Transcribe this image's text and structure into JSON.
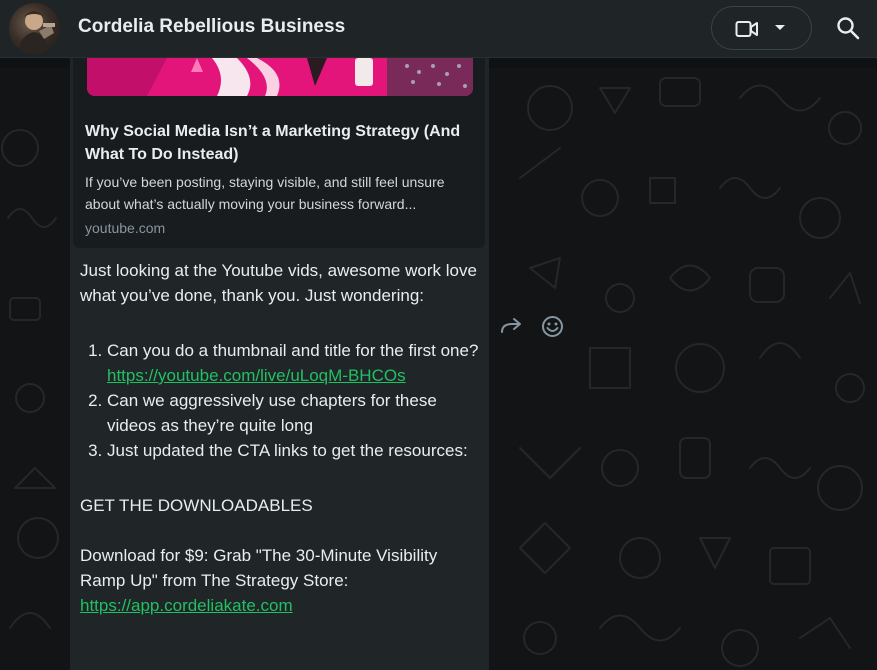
{
  "header": {
    "chat_title": "Cordelia Rebellious Business",
    "icons": [
      "avatar",
      "video-call-icon",
      "chevron-down-icon",
      "search-icon"
    ]
  },
  "link_preview": {
    "title": "Why Social Media Isn’t a Marketing Strategy (And What To Do Instead)",
    "description": "If you’ve been posting, staying visible, and still feel unsure about what’s actually moving your business forward...",
    "domain": "youtube.com"
  },
  "message": {
    "intro": "Just looking at the Youtube vids, awesome work love what you’ve done, thank you. Just wondering:",
    "item1_text": "Can you do a thumbnail and title for the first one? ",
    "item1_link": "https://youtube.com/live/uLoqM-BHCOs",
    "item2_text": "Can we aggressively use chapters for these videos as they’re quite long",
    "item3_text": "Just updated the CTA links to get the resources:",
    "downloadables": "GET THE DOWNLOADABLES",
    "download_text": "Download for $9: Grab \"The 30-Minute Visibility Ramp Up\" from The Strategy Store: ",
    "download_link": "https://app.cordeliakate.com"
  },
  "actions": {
    "icons": [
      "forward-icon",
      "emoji-icon"
    ]
  },
  "colors": {
    "header_bg": "#1f2427",
    "bubble_bg": "#202528",
    "link": "#21c063",
    "text": "#e9edef",
    "muted": "#8696a0"
  }
}
